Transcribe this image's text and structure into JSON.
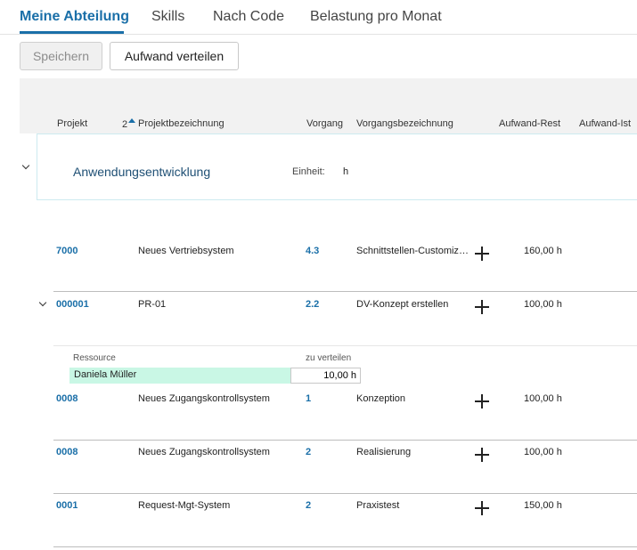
{
  "tabs": [
    {
      "label": "Meine Abteilung",
      "active": true
    },
    {
      "label": "Skills",
      "active": false
    },
    {
      "label": "Nach Code",
      "active": false
    },
    {
      "label": "Belastung pro Monat",
      "active": false
    }
  ],
  "toolbar": {
    "save_label": "Speichern",
    "save_enabled": false,
    "distribute_label": "Aufwand verteilen"
  },
  "columns": {
    "projekt": "Projekt",
    "sort_index": "2",
    "projektbezeichnung": "Projektbezeichnung",
    "vorgang": "Vorgang",
    "vorgangsbezeichnung": "Vorgangsbezeichnung",
    "aufwand_rest": "Aufwand-Rest",
    "aufwand_ist": "Aufwand-Ist"
  },
  "group": {
    "title": "Anwendungsentwicklung",
    "unit_label": "Einheit:",
    "unit_value": "h",
    "expanded": true
  },
  "rows": [
    {
      "projekt": "7000",
      "projektbezeichnung": "Neues Vertriebsystem",
      "vorgang": "4.3",
      "vorgangsbezeichnung": "Schnittstellen-Customizing",
      "aufwand_rest": "160,00 h"
    },
    {
      "projekt": "000001",
      "projektbezeichnung": "PR-01",
      "vorgang": "2.2",
      "vorgangsbezeichnung": "DV-Konzept erstellen",
      "aufwand_rest": "100,00 h"
    },
    {
      "projekt": "0008",
      "projektbezeichnung": "Neues Zugangskontrollsystem",
      "vorgang": "1",
      "vorgangsbezeichnung": "Konzeption",
      "aufwand_rest": "100,00 h"
    },
    {
      "projekt": "0008",
      "projektbezeichnung": "Neues Zugangskontrollsystem",
      "vorgang": "2",
      "vorgangsbezeichnung": "Realisierung",
      "aufwand_rest": "100,00 h"
    },
    {
      "projekt": "0001",
      "projektbezeichnung": "Request-Mgt-System",
      "vorgang": "2",
      "vorgangsbezeichnung": "Praxistest",
      "aufwand_rest": "150,00 h"
    }
  ],
  "subgrid": {
    "resource_label": "Ressource",
    "distribute_label": "zu verteilen",
    "resource_name": "Daniela Müller",
    "distribute_value": "10,00 h"
  },
  "colors": {
    "accent": "#1a6fa8",
    "resource_highlight": "#c9f7e5"
  },
  "icons": [
    "chevron-down-icon",
    "sort-ascending-icon",
    "plus-icon"
  ]
}
